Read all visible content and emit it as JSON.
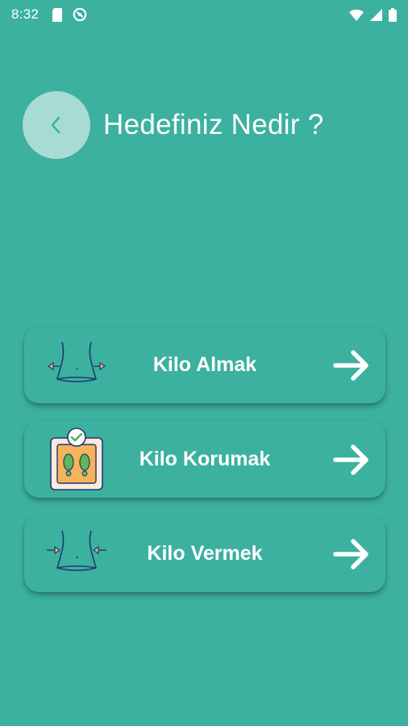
{
  "status_bar": {
    "time": "8:32",
    "left_icons": [
      "sd-card-icon",
      "vpn-icon"
    ],
    "right_icons": [
      "wifi-icon",
      "signal-icon",
      "battery-icon"
    ]
  },
  "header": {
    "back_icon": "chevron-left-icon",
    "title": "Hedefiniz Nedir ?"
  },
  "options": [
    {
      "label": "Kilo Almak",
      "icon": "waist-expand-icon",
      "arrow_icon": "arrow-right-icon"
    },
    {
      "label": "Kilo Korumak",
      "icon": "scale-check-icon",
      "arrow_icon": "arrow-right-icon"
    },
    {
      "label": "Kilo Vermek",
      "icon": "waist-shrink-icon",
      "arrow_icon": "arrow-right-icon"
    }
  ],
  "colors": {
    "background": "#3cb1a0",
    "back_button": "#a7dbd3",
    "text": "#ffffff"
  }
}
